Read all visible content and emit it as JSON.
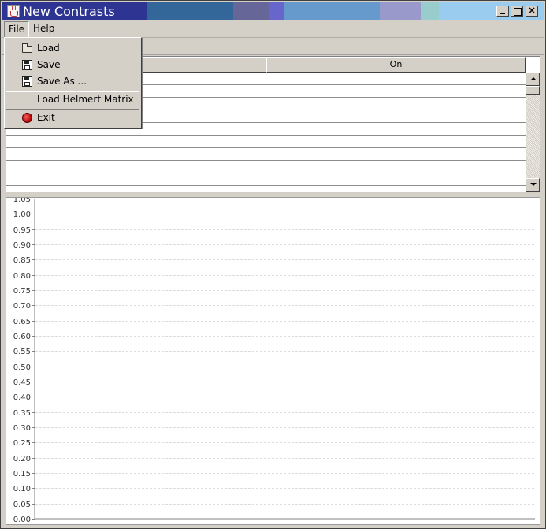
{
  "window": {
    "title": "New Contrasts",
    "controls": {
      "minimize": "_",
      "maximize": "□",
      "close": "×"
    }
  },
  "menubar": {
    "items": [
      {
        "label": "File"
      },
      {
        "label": "Help"
      }
    ]
  },
  "file_menu": {
    "items": [
      {
        "label": "Load",
        "icon": "folder-open-icon"
      },
      {
        "label": "Save",
        "icon": "floppy-disk-icon"
      },
      {
        "label": "Save As ...",
        "icon": "save-as-icon"
      },
      {
        "label": "Load Helmert Matrix",
        "icon": ""
      },
      {
        "label": "Exit",
        "icon": "exit-icon"
      }
    ]
  },
  "table": {
    "columns": [
      "",
      "On"
    ],
    "rows": [
      [
        "",
        ""
      ],
      [
        "",
        ""
      ],
      [
        "",
        ""
      ],
      [
        "",
        ""
      ],
      [
        "",
        ""
      ],
      [
        "",
        ""
      ],
      [
        "",
        ""
      ],
      [
        "",
        ""
      ],
      [
        "",
        ""
      ]
    ]
  },
  "chart_data": {
    "type": "line",
    "series": [],
    "ylim": [
      0,
      1.05
    ],
    "yticks": [
      "1.05",
      "1.00",
      "0.95",
      "0.90",
      "0.85",
      "0.80",
      "0.75",
      "0.70",
      "0.65",
      "0.60",
      "0.55",
      "0.50",
      "0.45",
      "0.40",
      "0.35",
      "0.30",
      "0.25",
      "0.20",
      "0.15",
      "0.10",
      "0.05",
      "0.00"
    ],
    "grid": true
  },
  "colors": {
    "titlebar_segments": [
      "#2e3492",
      "#336699",
      "#666699",
      "#6666cc",
      "#6699cc",
      "#9999cc",
      "#99cccc",
      "#99ccee"
    ],
    "title_text": "#ffffff",
    "gridline": "#dcdcdc"
  }
}
